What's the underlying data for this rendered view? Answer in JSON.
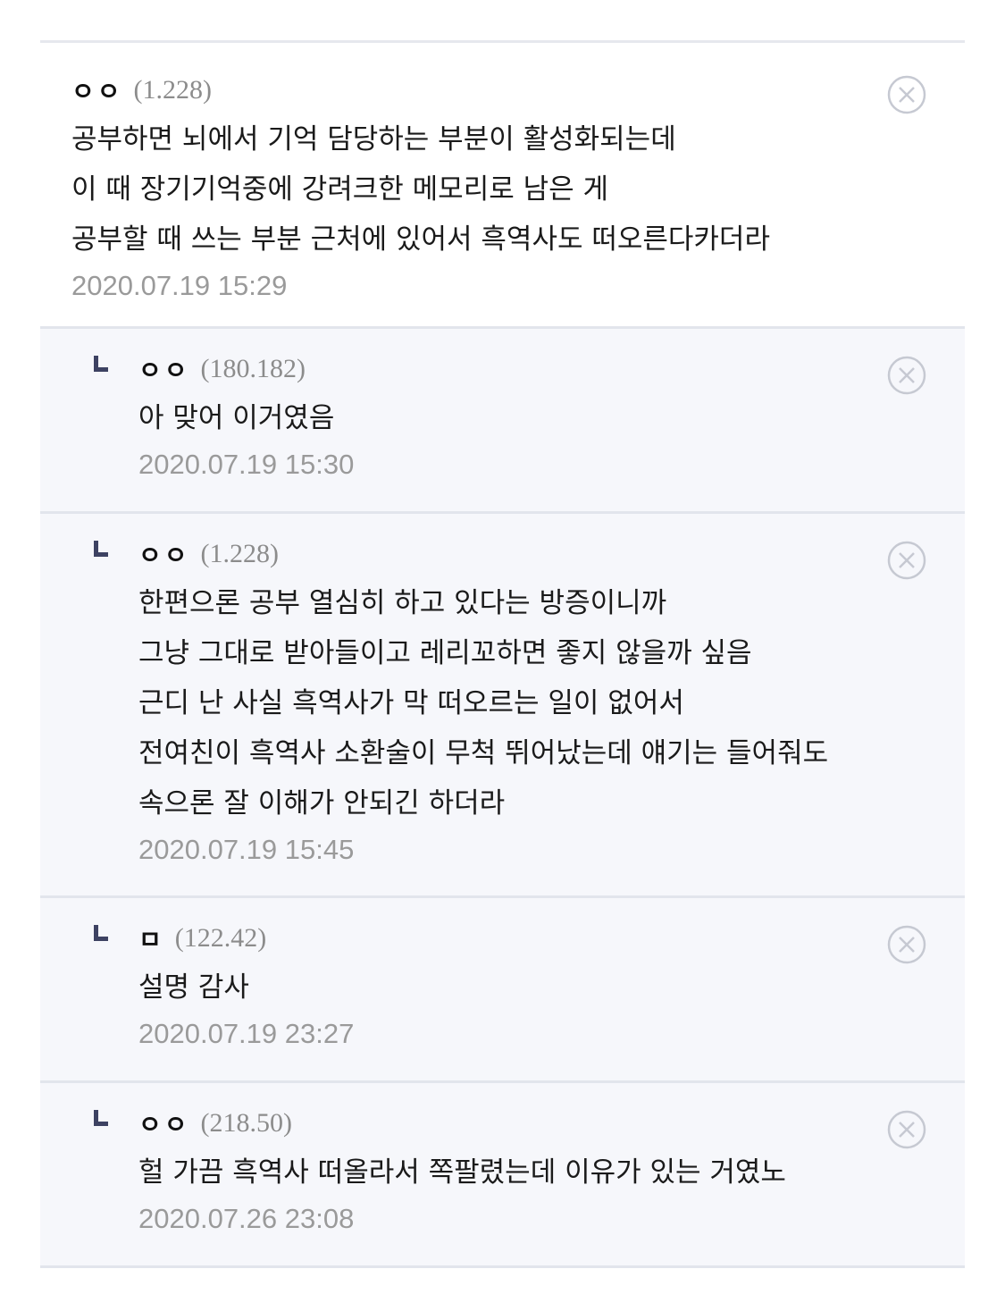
{
  "comments": [
    {
      "nickname": "ㅇㅇ",
      "ip": "(1.228)",
      "lines": [
        "공부하면 뇌에서 기억 담당하는 부분이 활성화되는데",
        "이 때 장기기억중에 강려크한 메모리로 남은 게",
        "공부할 때 쓰는 부분 근처에 있어서 흑역사도 떠오른다카더라"
      ],
      "date": "2020.07.19 15:29",
      "is_reply": false
    },
    {
      "nickname": "ㅇㅇ",
      "ip": "(180.182)",
      "lines": [
        "아 맞어 이거였음"
      ],
      "date": "2020.07.19 15:30",
      "is_reply": true
    },
    {
      "nickname": "ㅇㅇ",
      "ip": "(1.228)",
      "lines": [
        "한편으론 공부 열심히 하고 있다는 방증이니까",
        "그냥 그대로 받아들이고 레리꼬하면 좋지 않을까 싶음",
        "근디 난 사실 흑역사가 막 떠오르는 일이 없어서",
        "전여친이 흑역사 소환술이 무척 뛰어났는데 얘기는 들어줘도",
        "속으론 잘 이해가 안되긴 하더라"
      ],
      "date": "2020.07.19 15:45",
      "is_reply": true
    },
    {
      "nickname": "ㅁ",
      "ip": "(122.42)",
      "lines": [
        "설명 감사"
      ],
      "date": "2020.07.19 23:27",
      "is_reply": true
    },
    {
      "nickname": "ㅇㅇ",
      "ip": "(218.50)",
      "lines": [
        "헐 가끔 흑역사 떠올라서 쪽팔렸는데 이유가 있는 거였노"
      ],
      "date": "2020.07.26 23:08",
      "is_reply": true
    }
  ],
  "icons": {
    "delete": "close-circle-icon",
    "reply_marker": "reply-corner-icon"
  },
  "colors": {
    "reply_bg": "#f6f7fb",
    "divider": "#e2e5ec",
    "meta_text": "#9a9a9a",
    "reply_marker": "#3d4262"
  }
}
